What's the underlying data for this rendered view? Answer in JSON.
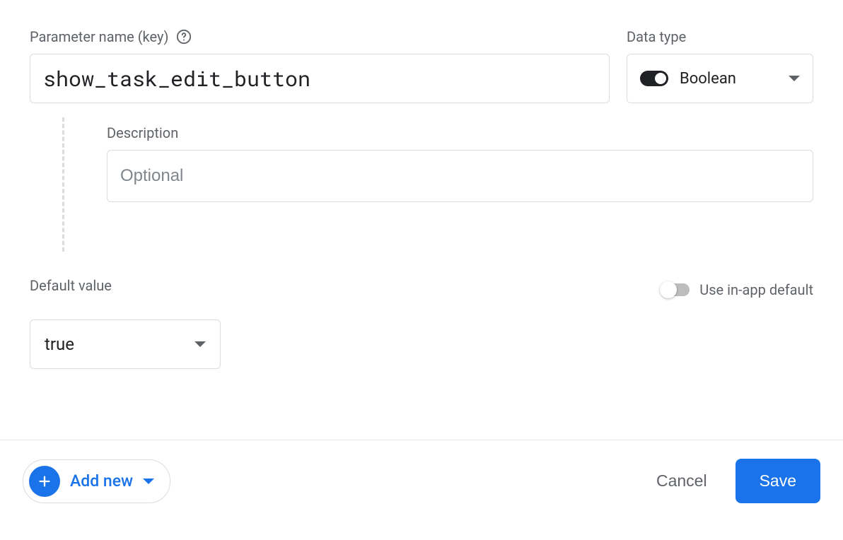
{
  "labels": {
    "parameter_name": "Parameter name (key)",
    "data_type": "Data type",
    "description": "Description",
    "default_value": "Default value",
    "use_inapp_default": "Use in-app default"
  },
  "fields": {
    "parameter_name_value": "show_task_edit_button",
    "data_type_value": "Boolean",
    "description_placeholder": "Optional",
    "description_value": "",
    "default_value_selected": "true",
    "use_inapp_default_on": false
  },
  "footer": {
    "add_new": "Add new",
    "cancel": "Cancel",
    "save": "Save"
  }
}
